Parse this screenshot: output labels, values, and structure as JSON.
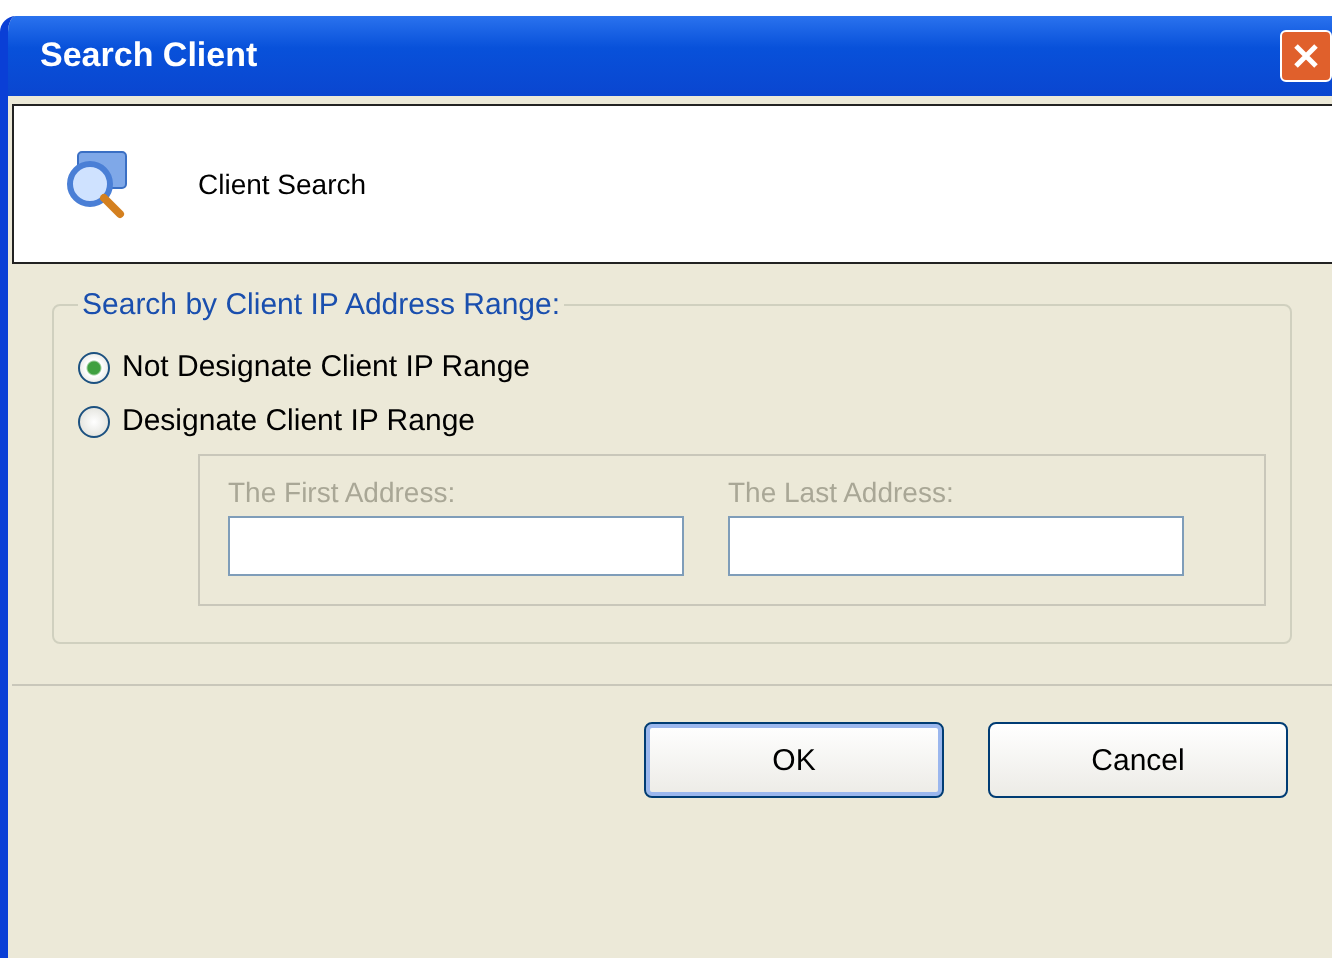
{
  "window": {
    "title": "Search Client"
  },
  "header": {
    "title": "Client Search"
  },
  "group": {
    "label": "Search by Client IP Address Range:"
  },
  "radios": [
    {
      "label": "Not Designate Client IP Range",
      "selected": true
    },
    {
      "label": "Designate Client IP Range",
      "selected": false
    }
  ],
  "range": {
    "disabled": true,
    "fields": [
      {
        "label": "The First Address:"
      },
      {
        "label": "The Last Address:"
      }
    ]
  },
  "buttons": [
    {
      "label": "OK",
      "default": true
    },
    {
      "label": "Cancel",
      "default": false
    }
  ]
}
